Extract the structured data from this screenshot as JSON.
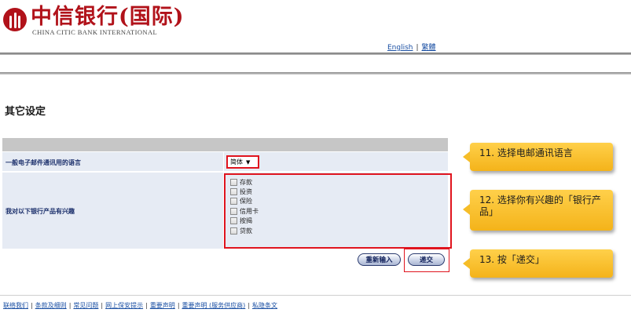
{
  "header": {
    "logo_cn": "中信银行(国际)",
    "logo_en": "CHINA CITIC BANK INTERNATIONAL",
    "brand_color": "#b1121a",
    "languages": [
      "English",
      "繁體"
    ]
  },
  "page": {
    "title": "其它设定"
  },
  "form": {
    "email_language": {
      "label": "一般电子邮件通讯用的语言",
      "selected": "简体"
    },
    "interests": {
      "label": "我对以下银行产品有兴趣",
      "options": [
        "存款",
        "投资",
        "保险",
        "信用卡",
        "按揭",
        "贷款"
      ]
    },
    "buttons": {
      "reset": "重新输入",
      "submit": "递交"
    }
  },
  "callouts": [
    "11. 选择电邮通讯语言",
    "12. 选择你有兴趣的「银行产品」",
    "13. 按「递交」"
  ],
  "footer": {
    "links": [
      "联络我们",
      "条款及细则",
      "常见问题",
      "网上保安提示",
      "重要声明",
      "重要声明 (服务供应商)",
      "私隐条文"
    ]
  }
}
